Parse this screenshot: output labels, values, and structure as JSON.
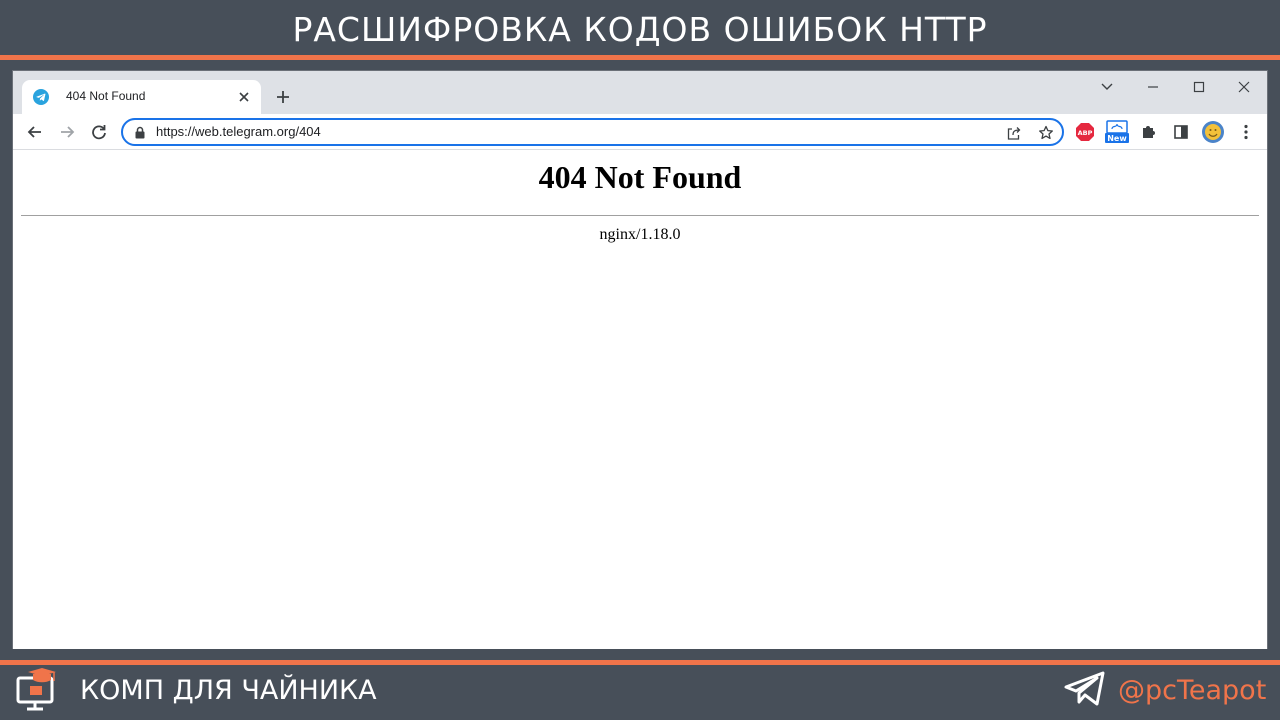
{
  "banner": {
    "title": "РАСШИФРОВКА КОДОВ ОШИБОК HTTP"
  },
  "browser": {
    "tab": {
      "title": "404 Not Found",
      "favicon": "telegram-icon"
    },
    "address_bar": {
      "url": "https://web.telegram.org/404"
    },
    "extensions": [
      {
        "name": "adblock-plus-icon",
        "label": "ABP",
        "color": "#e5283f"
      },
      {
        "name": "new-extension-icon",
        "label": "New",
        "color": "#1a73e8"
      },
      {
        "name": "puzzle-icon"
      },
      {
        "name": "side-panel-icon"
      },
      {
        "name": "profile-avatar"
      },
      {
        "name": "menu-kebab-icon"
      }
    ]
  },
  "page": {
    "heading": "404 Not Found",
    "server": "nginx/1.18.0"
  },
  "footer": {
    "site_name": "КОМП ДЛЯ ЧАЙНИКА",
    "handle": "@pcTeapot"
  },
  "colors": {
    "accent": "#f0744a",
    "bar_background": "#474f59",
    "focus_ring": "#1a73e8"
  }
}
